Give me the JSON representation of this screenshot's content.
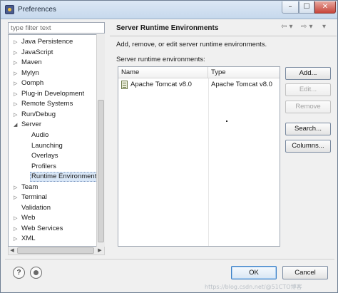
{
  "window": {
    "title": "Preferences",
    "min_glyph": "–",
    "max_glyph": "☐",
    "close_glyph": "✕"
  },
  "filter": {
    "placeholder": "type filter text",
    "value": ""
  },
  "tree": [
    {
      "label": "Java Persistence",
      "expander": "▷",
      "indent": 0
    },
    {
      "label": "JavaScript",
      "expander": "▷",
      "indent": 0
    },
    {
      "label": "Maven",
      "expander": "▷",
      "indent": 0
    },
    {
      "label": "Mylyn",
      "expander": "▷",
      "indent": 0
    },
    {
      "label": "Oomph",
      "expander": "▷",
      "indent": 0
    },
    {
      "label": "Plug-in Development",
      "expander": "▷",
      "indent": 0
    },
    {
      "label": "Remote Systems",
      "expander": "▷",
      "indent": 0
    },
    {
      "label": "Run/Debug",
      "expander": "▷",
      "indent": 0
    },
    {
      "label": "Server",
      "expander": "◢",
      "indent": 0
    },
    {
      "label": "Audio",
      "expander": "",
      "indent": 1
    },
    {
      "label": "Launching",
      "expander": "",
      "indent": 1
    },
    {
      "label": "Overlays",
      "expander": "",
      "indent": 1
    },
    {
      "label": "Profilers",
      "expander": "",
      "indent": 1
    },
    {
      "label": "Runtime Environment",
      "expander": "",
      "indent": 1,
      "selected": true
    },
    {
      "label": "Team",
      "expander": "▷",
      "indent": 0
    },
    {
      "label": "Terminal",
      "expander": "▷",
      "indent": 0
    },
    {
      "label": "Validation",
      "expander": "",
      "indent": 0
    },
    {
      "label": "Web",
      "expander": "▷",
      "indent": 0
    },
    {
      "label": "Web Services",
      "expander": "▷",
      "indent": 0
    },
    {
      "label": "XML",
      "expander": "▷",
      "indent": 0
    }
  ],
  "scroll": {
    "left_glyph": "◀",
    "right_glyph": "▶"
  },
  "page": {
    "title": "Server Runtime Environments",
    "nav": {
      "back": "⇦ ▾",
      "forward": "⇨ ▾",
      "menu": "▾"
    },
    "description": "Add, remove, or edit server runtime environments.",
    "table_label": "Server runtime environments:",
    "columns": [
      "Name",
      "Type"
    ],
    "rows": [
      {
        "name": "Apache Tomcat v8.0",
        "type": "Apache Tomcat v8.0"
      }
    ],
    "buttons": {
      "add": "Add...",
      "edit": "Edit...",
      "remove": "Remove",
      "search": "Search...",
      "columns": "Columns..."
    }
  },
  "footer": {
    "help_glyph": "?",
    "ok": "OK",
    "cancel": "Cancel",
    "watermark": "https://blog.csdn.net/@51CTO博客"
  }
}
